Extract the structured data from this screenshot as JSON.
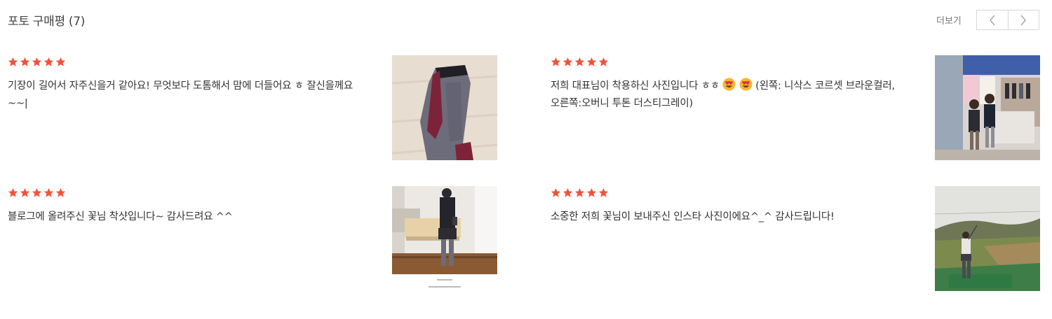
{
  "header": {
    "title": "포토 구매평 (7)",
    "more_label": "더보기",
    "prev_icon": "chevron-left-icon",
    "next_icon": "chevron-right-icon"
  },
  "colors": {
    "star": "#f0533a",
    "text": "#333333",
    "border": "#d9d9d9"
  },
  "reviews": [
    {
      "rating": 5,
      "text": "기장이 길어서 자주신을거 같아요! 무엇보다 도톰해서 맘에 더들어요 ㅎ 잘신을께요~~|",
      "image": "photo-socks-on-floor"
    },
    {
      "rating": 5,
      "text_before_emoji": "저희 대표님이 착용하신 사진입니다 ㅎㅎ",
      "text_after_emoji": "(왼쪽: 니삭스 코르셋 브라운컬러, 오른쪽:오버니 투톤 더스티그레이)",
      "emoji": "heart-eyes-emoji",
      "image": "photo-booth-exhibition"
    },
    {
      "rating": 5,
      "text": "블로그에 올려주신 꽃님 착샷입니다~ 감사드려요 ^^",
      "image": "photo-mirror-selfie"
    },
    {
      "rating": 5,
      "text": "소중한 저희 꽃님이 보내주신 인스타 사진이에요^_^ 감사드립니다!",
      "image": "photo-golf-range"
    }
  ]
}
